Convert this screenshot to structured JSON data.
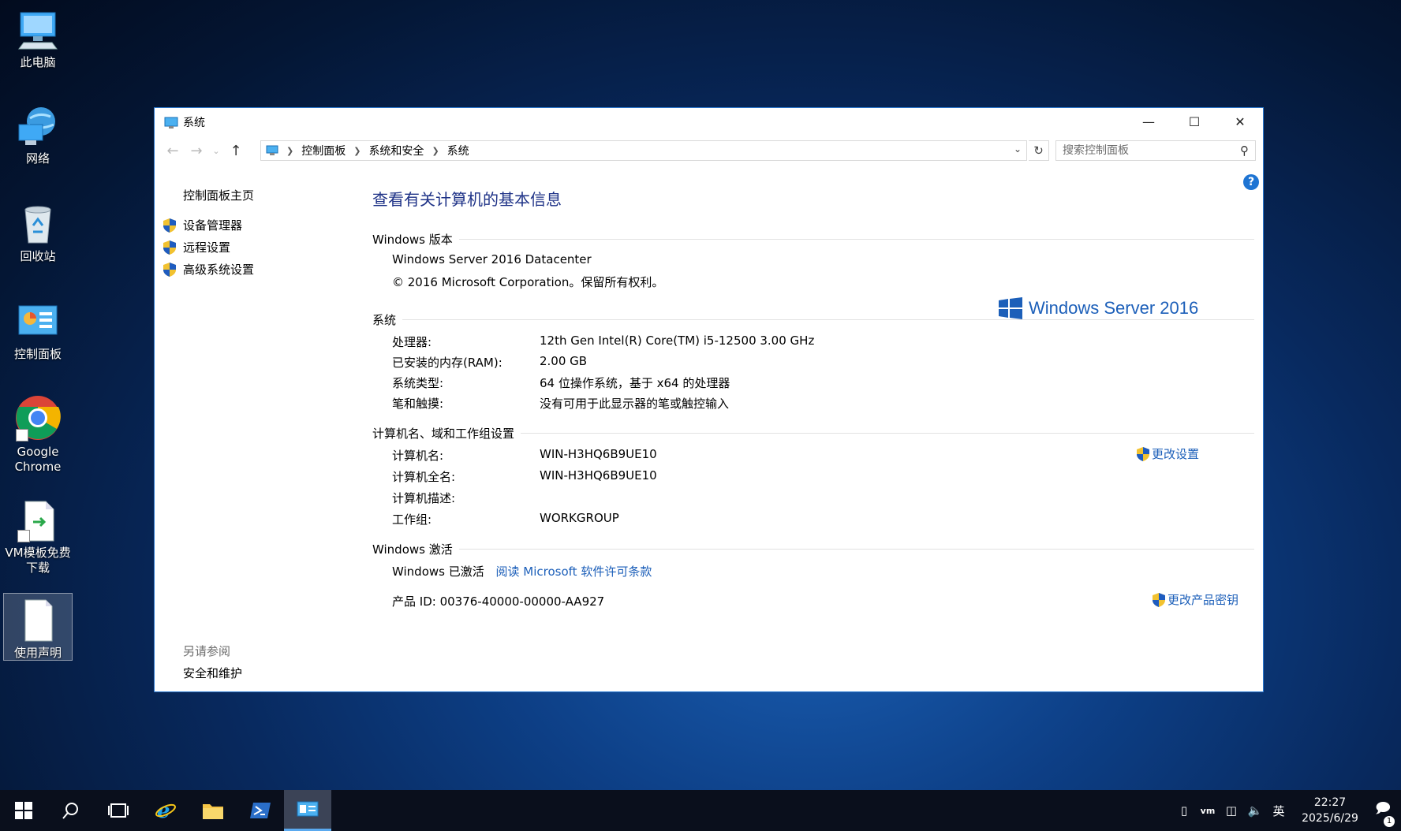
{
  "desktop": {
    "icons": [
      {
        "label": "此电脑"
      },
      {
        "label": "网络"
      },
      {
        "label": "回收站"
      },
      {
        "label": "控制面板"
      },
      {
        "label": "Google Chrome"
      },
      {
        "label": "VM模板免费下载"
      },
      {
        "label": "使用声明"
      }
    ]
  },
  "window": {
    "title": "系统",
    "breadcrumb": [
      "控制面板",
      "系统和安全",
      "系统"
    ],
    "search_placeholder": "搜索控制面板",
    "help_label": "?"
  },
  "left_pane": {
    "home": "控制面板主页",
    "links": [
      "设备管理器",
      "远程设置",
      "高级系统设置"
    ],
    "see_also": "另请参阅",
    "security": "安全和维护"
  },
  "main": {
    "heading": "查看有关计算机的基本信息",
    "windows_edition": {
      "title": "Windows 版本",
      "edition": "Windows Server 2016 Datacenter",
      "copyright": "© 2016 Microsoft Corporation。保留所有权利。",
      "logo_text": "Windows Server 2016"
    },
    "system": {
      "title": "系统",
      "rows": [
        {
          "label": "处理器:",
          "value": "12th Gen Intel(R) Core(TM) i5-12500   3.00 GHz"
        },
        {
          "label": "已安装的内存(RAM):",
          "value": "2.00 GB"
        },
        {
          "label": "系统类型:",
          "value": "64 位操作系统，基于 x64 的处理器"
        },
        {
          "label": "笔和触摸:",
          "value": "没有可用于此显示器的笔或触控输入"
        }
      ]
    },
    "computer": {
      "title": "计算机名、域和工作组设置",
      "change_settings": "更改设置",
      "rows": [
        {
          "label": "计算机名:",
          "value": "WIN-H3HQ6B9UE10"
        },
        {
          "label": "计算机全名:",
          "value": "WIN-H3HQ6B9UE10"
        },
        {
          "label": "计算机描述:",
          "value": ""
        },
        {
          "label": "工作组:",
          "value": "WORKGROUP"
        }
      ]
    },
    "activation": {
      "title": "Windows 激活",
      "status": "Windows 已激活",
      "license_link": "阅读 Microsoft 软件许可条款",
      "product_id": "产品 ID: 00376-40000-00000-AA927",
      "change_key": "更改产品密钥"
    }
  },
  "taskbar": {
    "ime": "英",
    "time": "22:27",
    "date": "2025/6/29",
    "notification_count": "1"
  },
  "colors": {
    "accent": "#1c5fb9",
    "heading": "#1e3287",
    "window_border": "#2b79d0",
    "taskbar": "#0a0f1c"
  }
}
